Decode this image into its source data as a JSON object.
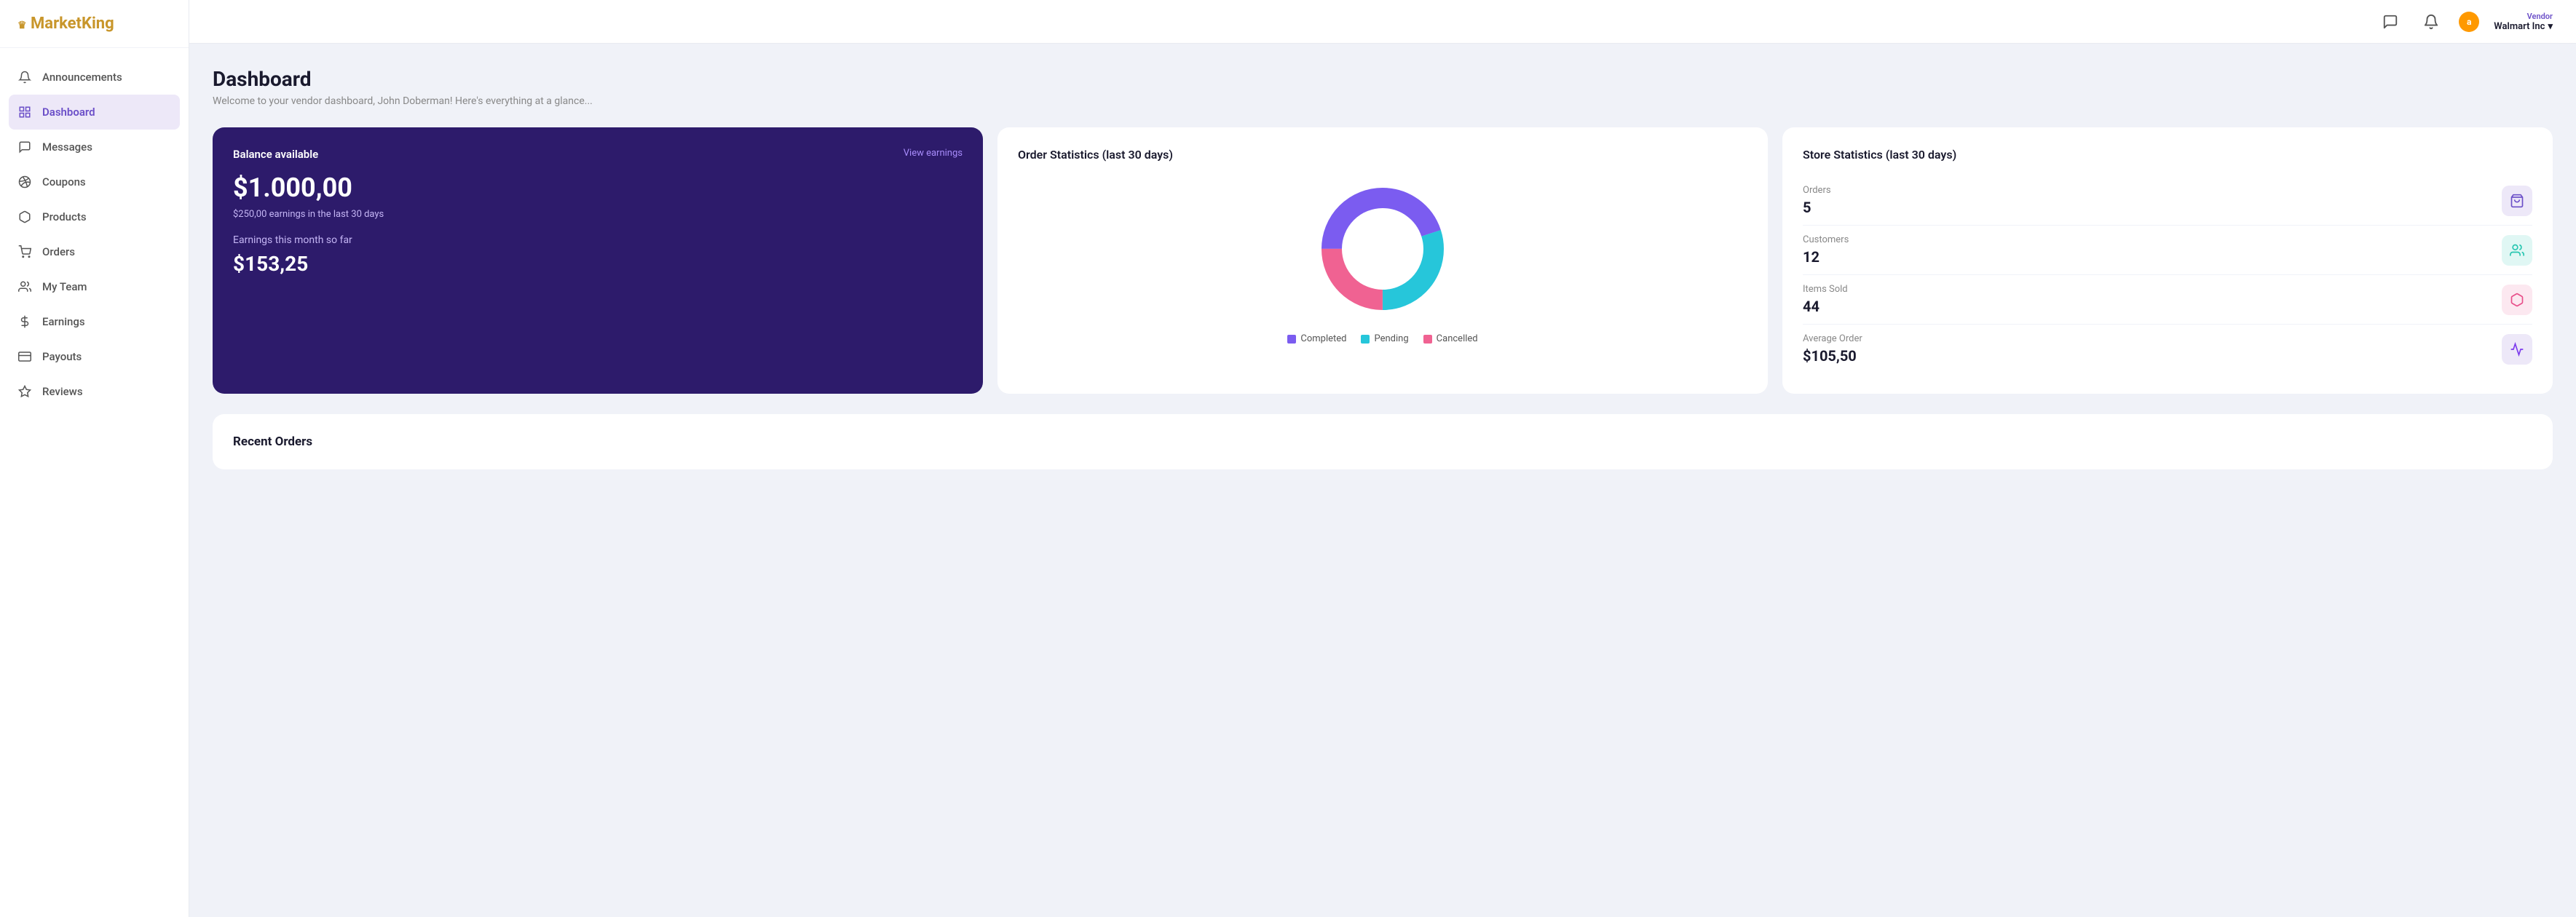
{
  "logo": {
    "brand": "Market",
    "brand_highlight": "King",
    "crown": "♛"
  },
  "nav": {
    "items": [
      {
        "id": "announcements",
        "label": "Announcements",
        "icon": "🔔"
      },
      {
        "id": "dashboard",
        "label": "Dashboard",
        "icon": "⊞",
        "active": true
      },
      {
        "id": "messages",
        "label": "Messages",
        "icon": "💬"
      },
      {
        "id": "coupons",
        "label": "Coupons",
        "icon": "🏷️"
      },
      {
        "id": "products",
        "label": "Products",
        "icon": "📦"
      },
      {
        "id": "orders",
        "label": "Orders",
        "icon": "🛒"
      },
      {
        "id": "my-team",
        "label": "My Team",
        "icon": "👥"
      },
      {
        "id": "earnings",
        "label": "Earnings",
        "icon": "💰"
      },
      {
        "id": "payouts",
        "label": "Payouts",
        "icon": "💳"
      },
      {
        "id": "reviews",
        "label": "Reviews",
        "icon": "⭐"
      }
    ]
  },
  "header": {
    "chat_icon": "💬",
    "bell_icon": "🔔",
    "vendor_label": "Vendor",
    "vendor_name": "Walmart Inc",
    "chevron": "▾"
  },
  "page": {
    "title": "Dashboard",
    "subtitle": "Welcome to your vendor dashboard, John Doberman! Here's everything at a glance..."
  },
  "balance_card": {
    "label": "Balance available",
    "view_earnings": "View earnings",
    "amount": "$1.000,00",
    "sub_text": "$250,00 earnings in the last 30 days",
    "month_label": "Earnings this month so far",
    "month_amount": "$153,25"
  },
  "order_stats": {
    "title": "Order Statistics (last 30 days)",
    "legend": [
      {
        "label": "Completed",
        "color": "#7b5cf0"
      },
      {
        "label": "Pending",
        "color": "#26c6da"
      },
      {
        "label": "Cancelled",
        "color": "#f06292"
      }
    ],
    "donut": {
      "completed_pct": 45,
      "pending_pct": 30,
      "cancelled_pct": 25
    }
  },
  "store_stats": {
    "title": "Store Statistics (last 30 days)",
    "items": [
      {
        "label": "Orders",
        "value": "5",
        "icon": "🛍️",
        "icon_class": "purple"
      },
      {
        "label": "Customers",
        "value": "12",
        "icon": "👤",
        "icon_class": "teal"
      },
      {
        "label": "Items Sold",
        "value": "44",
        "icon": "📦",
        "icon_class": "pink"
      },
      {
        "label": "Average Order",
        "value": "$105,50",
        "icon": "📊",
        "icon_class": "violet"
      }
    ]
  },
  "recent_orders": {
    "title": "Recent Orders"
  }
}
